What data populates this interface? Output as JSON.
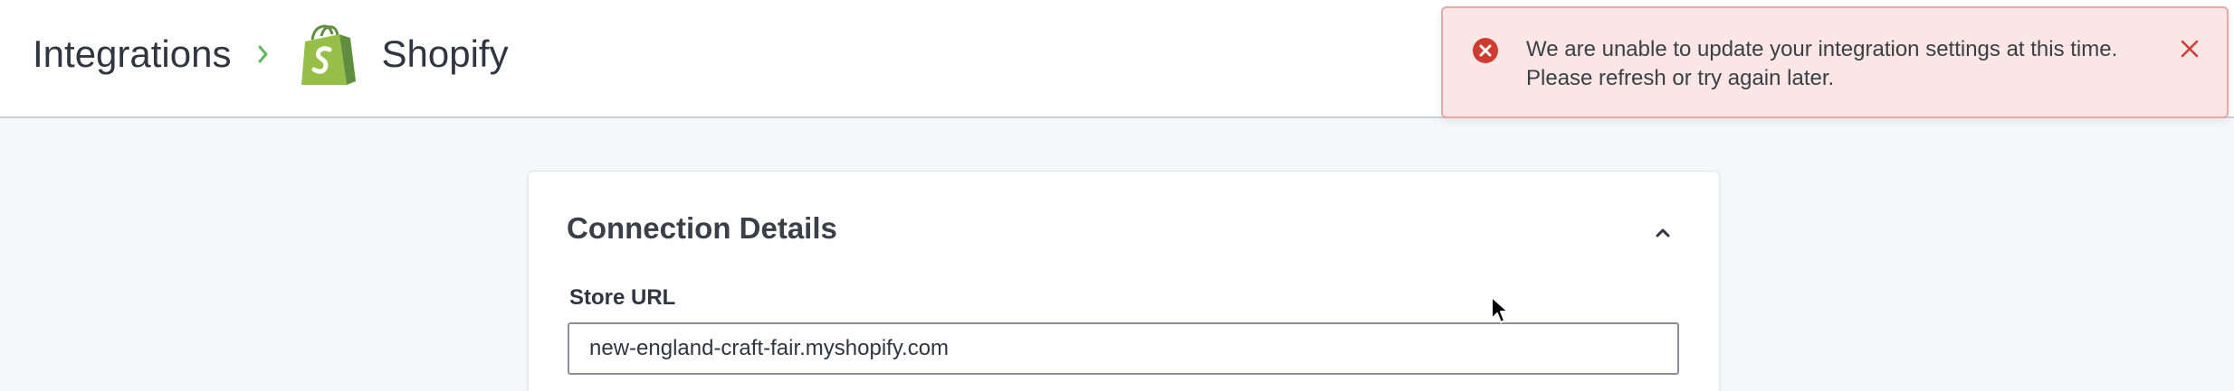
{
  "header": {
    "breadcrumb": {
      "parent_label": "Integrations",
      "current_label": "Shopify"
    }
  },
  "toast": {
    "type": "error",
    "message": "We are unable to update your integration settings at this time. Please refresh or try again later."
  },
  "card": {
    "title": "Connection Details",
    "store_url": {
      "label": "Store URL",
      "value": "new-england-craft-fair.myshopify.com"
    }
  },
  "colors": {
    "breadcrumb_chevron": "#5cb85c",
    "shopify_green": "#95bf47",
    "shopify_dark_green": "#5e8e3e",
    "error_red": "#d13b2f",
    "toast_bg": "#fbe6e6",
    "toast_border": "#e9a8a3"
  },
  "icons": {
    "breadcrumb_separator": "chevron-right-icon",
    "app_logo": "shopify-bag-icon",
    "toast_status": "error-circle-x-icon",
    "toast_dismiss": "close-icon",
    "card_toggle": "chevron-up-icon"
  }
}
